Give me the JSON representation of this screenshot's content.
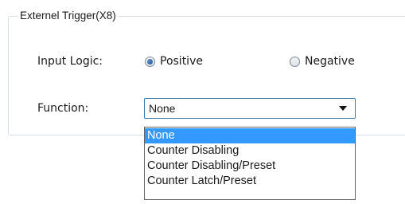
{
  "group": {
    "title": "Externel Trigger(X8)"
  },
  "input_logic": {
    "label": "Input Logic:",
    "options": [
      {
        "label": "Positive",
        "selected": true
      },
      {
        "label": "Negative",
        "selected": false
      }
    ]
  },
  "function": {
    "label": "Function:",
    "selected_value": "None",
    "options": [
      "None",
      "Counter Disabling",
      "Counter Disabling/Preset",
      "Counter Latch/Preset"
    ],
    "highlighted_index": 0
  },
  "colors": {
    "highlight": "#3399ff",
    "combo_border": "#3d7bad",
    "group_border": "#d5dfe5"
  }
}
